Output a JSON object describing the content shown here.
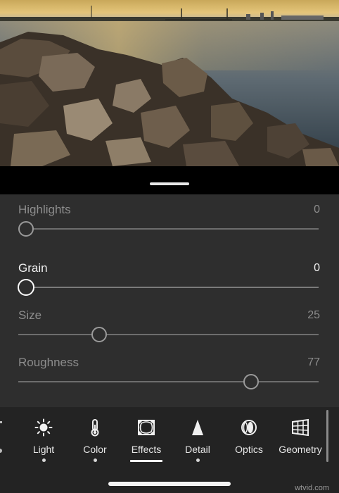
{
  "photo": {
    "description_icon": "landscape-photo"
  },
  "sliders": [
    {
      "id": "highlights",
      "label": "Highlights",
      "value": "0",
      "level": 0.0,
      "active": false
    },
    {
      "id": "grain",
      "label": "Grain",
      "value": "0",
      "level": 0.0,
      "active": true
    },
    {
      "id": "size",
      "label": "Size",
      "value": "25",
      "level": 0.25,
      "active": false
    },
    {
      "id": "roughness",
      "label": "Roughness",
      "value": "77",
      "level": 0.77,
      "active": false
    }
  ],
  "toolbar": {
    "items": [
      {
        "label": "Light",
        "icon": "sun-icon",
        "has_dot": true,
        "selected": false
      },
      {
        "label": "Color",
        "icon": "thermometer-icon",
        "has_dot": true,
        "selected": false
      },
      {
        "label": "Effects",
        "icon": "effects-icon",
        "has_dot": false,
        "selected": true
      },
      {
        "label": "Detail",
        "icon": "triangle-icon",
        "has_dot": true,
        "selected": false
      },
      {
        "label": "Optics",
        "icon": "lens-icon",
        "has_dot": false,
        "selected": false
      },
      {
        "label": "Geometry",
        "icon": "grid-perspective-icon",
        "has_dot": false,
        "selected": false
      }
    ]
  },
  "watermark": "wtvid.com",
  "colors": {
    "panel": "#2e2e2e",
    "toolbar": "#232323",
    "accent": "#ffffff"
  }
}
